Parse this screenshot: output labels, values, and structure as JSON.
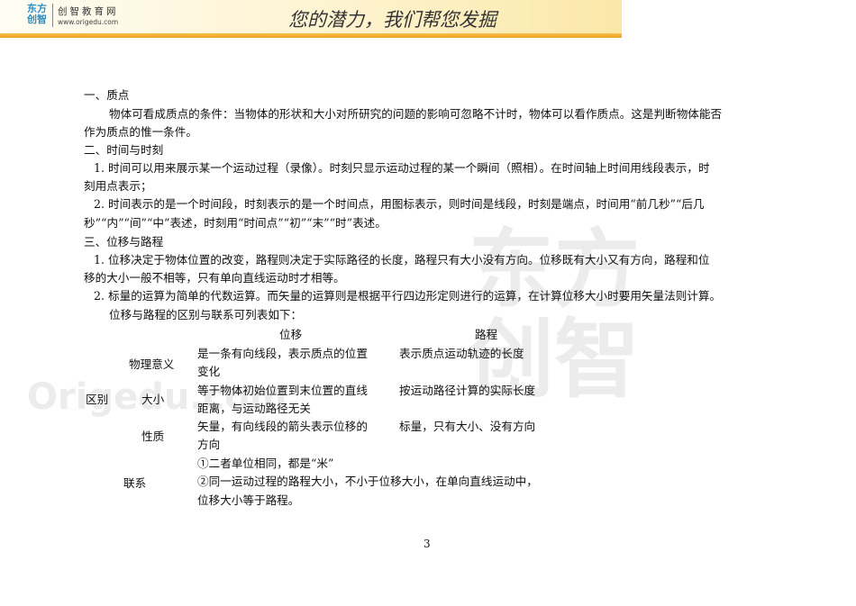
{
  "header": {
    "logo_text": "东方创智",
    "brand": "创智教育网",
    "url": "www.origedu.com",
    "slogan": "您的潜力，我们帮您发掘"
  },
  "watermark": {
    "text": "Origedu.com",
    "logo": "东方创智"
  },
  "lines": [
    "一、质点",
    "物体可看成质点的条件：当物体的形状和大小对所研究的问题的影响可忽略不计时，物体可以看作质点。这是判断物体能否",
    "作为质点的惟一条件。",
    "二、时间与时刻",
    "1. 时间可以用来展示某一个运动过程（录像）。时刻只显示运动过程的某一个瞬间（照相）。在时间轴上时间用线段表示，时",
    "刻用点表示；",
    "2. 时间表示的是一个时间段，时刻表示的是一个时间点，用图标表示，则时间是线段，时刻是端点，时间用“前几秒”“后几",
    "秒”“内”“间”“中”表述，时刻用“时间点”“初”“末”“时”表述。",
    "三、位移与路程",
    "1. 位移决定于物体位置的改变，路程则决定于实际路径的长度，路程只有大小没有方向。位移既有大小又有方向，路程和位",
    "移的大小一般不相等，只有单向直线运动时才相等。",
    "2. 标量的运算为简单的代数运算。而矢量的运算则是根据平行四边形定则进行的运算，在计算位移大小时要用矢量法则计算。",
    "位移与路程的区别与联系可列表如下："
  ],
  "table": {
    "headers": [
      "位移",
      "路程"
    ],
    "group": "区别",
    "rows": [
      {
        "label": "物理意义",
        "disp": [
          "是一条有向线段，表示质点的位置",
          "变化"
        ],
        "path": "表示质点运动轨迹的长度"
      },
      {
        "label": "大小",
        "disp": [
          "等于物体初始位置到末位置的直线",
          "距离，与运动路径无关"
        ],
        "path": "按运动路径计算的实际长度"
      },
      {
        "label": "性质",
        "disp": [
          "矢量，有向线段的箭头表示位移的",
          "方向"
        ],
        "path": "标量，只有大小、没有方向"
      }
    ],
    "relation": {
      "label": "联系",
      "lines": [
        "①二者单位相同，都是“米”",
        "②同一运动过程的路程大小，不小于位移大小，在单向直线运动中，",
        "位移大小等于路程。"
      ]
    }
  },
  "page_number": "3"
}
